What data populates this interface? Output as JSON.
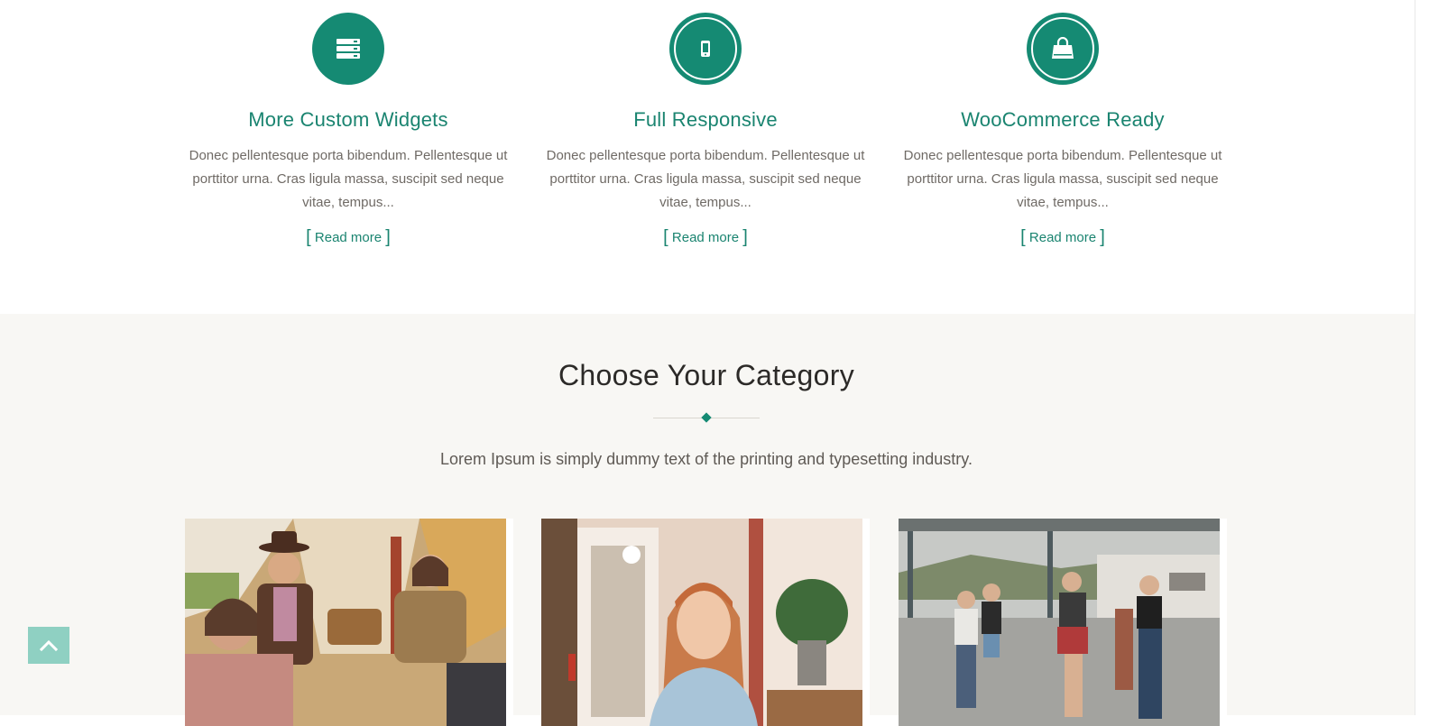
{
  "features": [
    {
      "icon": "server-icon",
      "title": "More Custom Widgets",
      "text": "Donec pellentesque porta bibendum. Pellentesque ut porttitor urna. Cras ligula massa, suscipit sed neque vitae, tempus...",
      "link": "Read more"
    },
    {
      "icon": "mobile-icon",
      "title": "Full Responsive",
      "text": "Donec pellentesque porta bibendum. Pellentesque ut porttitor urna. Cras ligula massa, suscipit sed neque vitae, tempus...",
      "link": "Read more"
    },
    {
      "icon": "shopping-bag-icon",
      "title": "WooCommerce Ready",
      "text": "Donec pellentesque porta bibendum. Pellentesque ut porttitor urna. Cras ligula massa, suscipit sed neque vitae, tempus...",
      "link": "Read more"
    }
  ],
  "link_brackets": {
    "open": "[",
    "close": "]"
  },
  "category": {
    "heading": "Choose Your Category",
    "subheading": "Lorem Ipsum is simply dummy text of the printing and typesetting industry.",
    "cards": [
      {
        "image": "friends-camping-photo"
      },
      {
        "image": "woman-smiling-cafe-photo"
      },
      {
        "image": "women-walking-photo"
      }
    ]
  },
  "back_to_top": {
    "icon": "chevron-up-icon"
  },
  "colors": {
    "accent": "#158a73",
    "accent_text": "#1a8470",
    "section_bg": "#f8f7f4",
    "back_to_top_bg": "#8fd0c2"
  }
}
